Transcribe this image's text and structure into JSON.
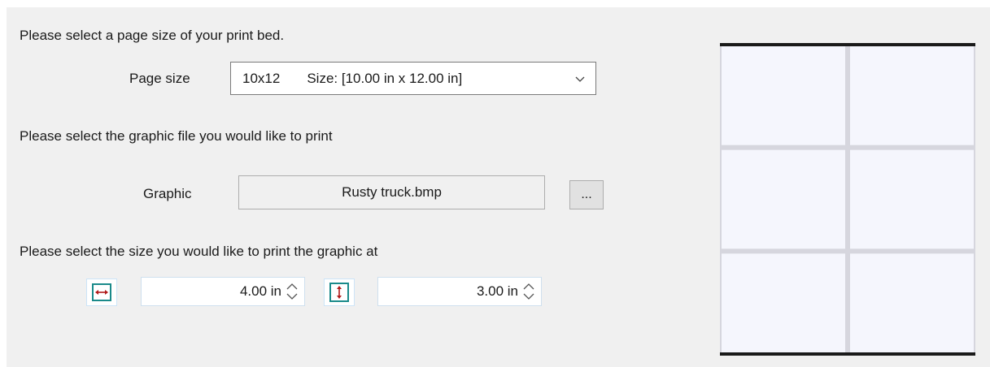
{
  "page_size": {
    "instruction": "Please select a page size of your print bed.",
    "label": "Page size",
    "selected_name": "10x12",
    "selected_size": "Size: [10.00 in x 12.00 in]"
  },
  "graphic": {
    "instruction": "Please select the graphic file you would like to print",
    "label": "Graphic",
    "filename": "Rusty truck.bmp",
    "browse_label": "..."
  },
  "print_size": {
    "instruction": "Please select the size you would like to print the graphic at",
    "width_value": "4.00 in",
    "height_value": "3.00 in"
  },
  "preview": {
    "columns": 2,
    "rows": 3
  },
  "colors": {
    "panel_bg": "#f0f0f0",
    "preview_tile": "#f5f6fd",
    "preview_gutter": "#d6d6de",
    "preview_bar": "#1a1a1a",
    "icon_teal": "#1a8a8a",
    "icon_red": "#b01a1a"
  }
}
